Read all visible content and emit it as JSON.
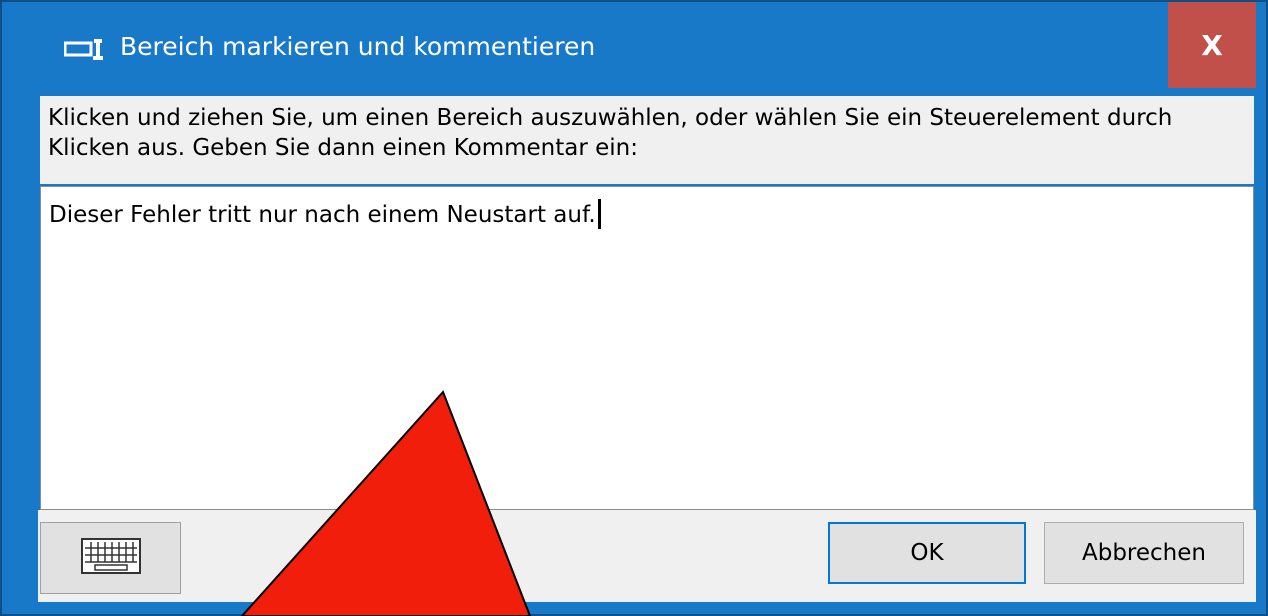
{
  "window": {
    "title": "Bereich markieren und kommentieren",
    "close_label": "X"
  },
  "instructions": "Klicken und ziehen Sie, um einen Bereich auszuwählen, oder wählen Sie ein Steuerelement durch Klicken aus. Geben Sie dann einen Kommentar ein:",
  "comment": {
    "value": "Dieser Fehler tritt nur nach einem Neustart auf."
  },
  "buttons": {
    "ok": "OK",
    "cancel": "Abbrechen"
  },
  "icons": {
    "app": "screen-region-icon",
    "keyboard": "keyboard-icon"
  },
  "colors": {
    "titlebar": "#1979c9",
    "close": "#c2504a",
    "annotation_arrow": "#f01e0a"
  }
}
